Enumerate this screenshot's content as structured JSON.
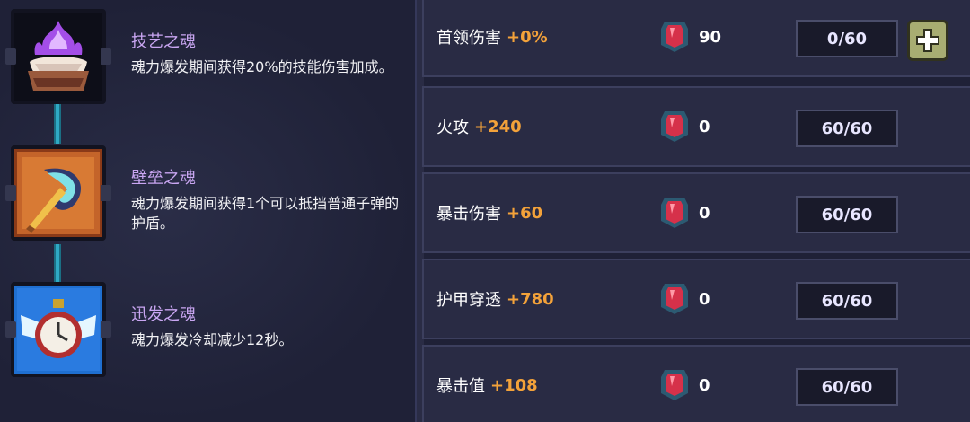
{
  "souls": [
    {
      "title": "技艺之魂",
      "desc": "魂力爆发期间获得20%的技能伤害加成。",
      "icon": "purple-flame-shell-icon"
    },
    {
      "title": "壁垒之魂",
      "desc": "魂力爆发期间获得1个可以抵挡普通子弹的护盾。",
      "icon": "shield-axe-icon"
    },
    {
      "title": "迅发之魂",
      "desc": "魂力爆发冷却减少12秒。",
      "icon": "winged-clock-icon"
    }
  ],
  "stats": [
    {
      "label": "首领伤害",
      "bonus": "+0%",
      "gems": "90",
      "level": "0/60",
      "has_plus": true
    },
    {
      "label": "火攻",
      "bonus": "+240",
      "gems": "0",
      "level": "60/60",
      "has_plus": false
    },
    {
      "label": "暴击伤害",
      "bonus": "+60",
      "gems": "0",
      "level": "60/60",
      "has_plus": false
    },
    {
      "label": "护甲穿透",
      "bonus": "+780",
      "gems": "0",
      "level": "60/60",
      "has_plus": false
    },
    {
      "label": "暴击值",
      "bonus": "+108",
      "gems": "0",
      "level": "60/60",
      "has_plus": false
    }
  ],
  "colors": {
    "soul_title": "#c9a6f2",
    "bonus": "#f3a23a",
    "link": "#2fa9c4",
    "plus_button": "#a8ad72"
  }
}
